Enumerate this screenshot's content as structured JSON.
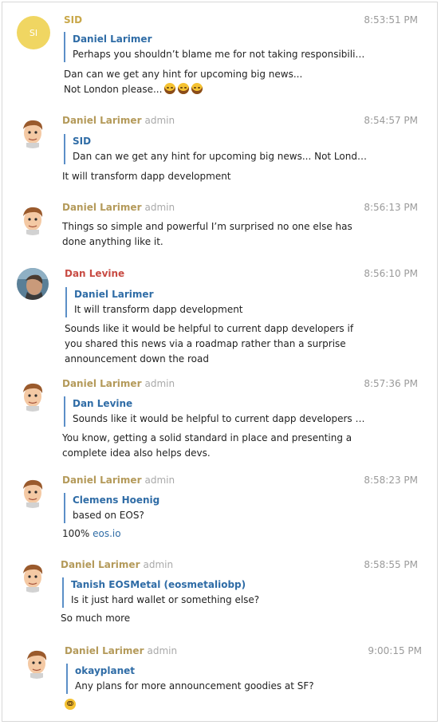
{
  "messages": [
    {
      "sender": "SID",
      "initials": "SI",
      "role": "",
      "time": "8:53:51 PM",
      "quote_name": "Daniel Larimer",
      "quote_text": "Perhaps you shouldn’t blame me for not taking responsibili…",
      "body_lines": [
        "Dan can we get any hint for upcoming big news...",
        "Not London please..."
      ],
      "emoji": [
        "joy-emoji",
        "joy-emoji",
        "joy-emoji"
      ]
    },
    {
      "sender": "Daniel Larimer",
      "role": "admin",
      "time": "8:54:57 PM",
      "quote_name": "SID",
      "quote_text": "Dan can we get any hint for upcoming big news... Not Lond…",
      "body_lines": [
        "It will transform dapp development"
      ]
    },
    {
      "sender": "Daniel Larimer",
      "role": "admin",
      "time": "8:56:13 PM",
      "body_lines": [
        "Things so simple and powerful I’m surprised no one else has",
        "done anything like it."
      ]
    },
    {
      "sender": "Dan Levine",
      "role": "",
      "time": "8:56:10 PM",
      "quote_name": "Daniel Larimer",
      "quote_text": "It will transform dapp development",
      "body_lines": [
        "Sounds like it would be helpful to current dapp developers if",
        "you shared this news via a roadmap rather than a surprise",
        "announcement down the road"
      ]
    },
    {
      "sender": "Daniel Larimer",
      "role": "admin",
      "time": "8:57:36 PM",
      "quote_name": "Dan Levine",
      "quote_text": "Sounds like it would be helpful to current dapp developers …",
      "body_lines": [
        "You know, getting a solid standard in place and presenting a",
        "complete idea also helps devs."
      ]
    },
    {
      "sender": "Daniel Larimer",
      "role": "admin",
      "time": "8:58:23 PM",
      "quote_name": "Clemens Hoenig",
      "quote_text": "based on EOS?",
      "body_prefix": "100% ",
      "body_link": "eos.io"
    },
    {
      "sender": "Daniel Larimer",
      "role": "admin",
      "time": "8:58:55 PM",
      "quote_name": "Tanish EOSMetal (eosmetaliobp)",
      "quote_text": "Is it just hard wallet or something else?",
      "body_lines": [
        "So much more"
      ]
    },
    {
      "sender": "Daniel Larimer",
      "role": "admin",
      "time": "9:00:15 PM",
      "quote_name": "okayplanet",
      "quote_text": "Any plans for more announcement goodies at SF?",
      "emoji": [
        "nerd-face-emoji"
      ]
    }
  ],
  "colors": {
    "daniel_name": "#b49a5a",
    "sid_name": "#c9a84a",
    "levine_name": "#c84b43",
    "quote_bar": "#5b8fc7",
    "quote_name": "#2f6ca6"
  }
}
